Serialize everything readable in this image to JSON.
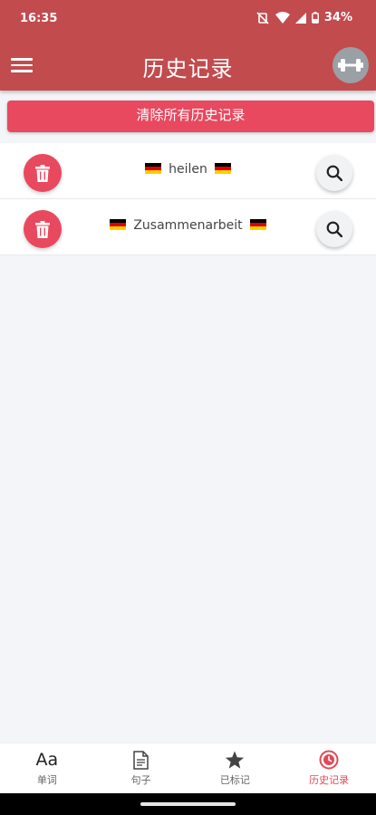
{
  "status": {
    "time": "16:35",
    "battery": "34%"
  },
  "appbar": {
    "title": "历史记录"
  },
  "clear_button": "清除所有历史记录",
  "history": [
    {
      "word": "heilen"
    },
    {
      "word": "Zusammenarbeit"
    }
  ],
  "nav": [
    {
      "label": "单词",
      "icon": "letters-aa-icon",
      "active": false
    },
    {
      "label": "句子",
      "icon": "document-icon",
      "active": false
    },
    {
      "label": "已标记",
      "icon": "star-icon",
      "active": false
    },
    {
      "label": "历史记录",
      "icon": "history-icon",
      "active": true
    }
  ],
  "colors": {
    "appbar": "#c24b4e",
    "accent": "#e8495f",
    "background": "#f3f5f8"
  }
}
